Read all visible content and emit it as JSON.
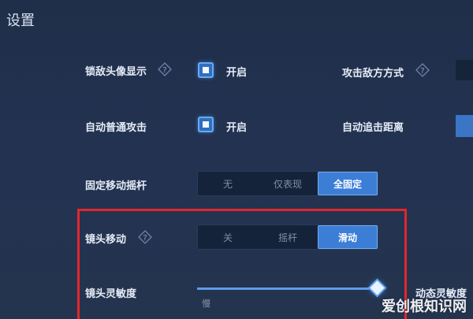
{
  "title": "设置",
  "rows": {
    "lock_avatar": {
      "label": "锁敌头像显示",
      "state_label": "开启"
    },
    "attack_mode": {
      "label": "攻击敌方方式"
    },
    "auto_attack": {
      "label": "自动普通攻击",
      "state_label": "开启"
    },
    "auto_chase": {
      "label": "自动追击距离"
    },
    "fixed_joystick": {
      "label": "固定移动摇杆",
      "options": [
        "无",
        "仅表现",
        "全固定"
      ],
      "selected": "全固定"
    },
    "camera_move": {
      "label": "镜头移动",
      "options": [
        "关",
        "摇杆",
        "滑动"
      ],
      "selected": "滑动"
    },
    "camera_sensitivity": {
      "label": "镜头灵敏度",
      "value_fraction": 0.97,
      "min_label": "慢"
    },
    "dynamic_sensitivity": {
      "label": "动态灵敏度"
    }
  },
  "colors": {
    "accent": "#3c7ed6",
    "highlight_border": "#e3262b",
    "background": "#223250"
  },
  "watermark": "爱创根知识网"
}
